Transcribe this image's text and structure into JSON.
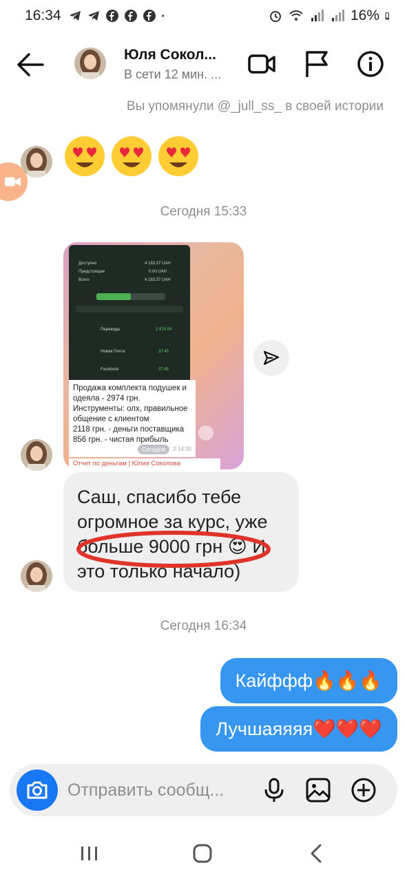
{
  "status_bar": {
    "time": "16:34",
    "battery": "16%"
  },
  "header": {
    "name": "Юля Сокол...",
    "status": "В сети 12 мин. ..."
  },
  "mention_note": "Вы упомянули @_jull_ss_ в своей истории",
  "reaction_emojis": "😍😍😍",
  "date_sep_1": "Сегодня 15:33",
  "shared_image": {
    "phone_rows": [
      "Доступно",
      "4 183.37 UAH",
      "Предстоящие",
      "0.00 UAH",
      "Всего",
      "4 183.37 UAH",
      "Переводы",
      "2 974.00",
      "Новая Почта",
      "37.45",
      "Facebook",
      "37.45"
    ],
    "caption_lines": [
      "Продажа комплекта подушек и",
      "одеяла - 2974 грн.",
      "Инструменты: олх, правильное",
      "общение с клиентом",
      "2118 грн. - деньги поставщика",
      "856 грн. - чистая прибыль"
    ],
    "caption_time": "2 14:30",
    "today_pill": "Сегодня",
    "report_label": "Отчет по деньгам | Юлия Соколова"
  },
  "incoming_message": "Саш, спасибо тебе огромное за курс, уже больше 9000 грн 😍 И это только начало)",
  "date_sep_2": "Сегодня 16:34",
  "outgoing_messages": [
    "Кайффф🔥🔥🔥",
    "Лучшаяяяя❤️❤️❤️"
  ],
  "composer": {
    "placeholder": "Отправить сообщ..."
  },
  "colors": {
    "accent": "#3797f0",
    "camera": "#1877f2",
    "bubble_in": "#efefef",
    "annotation": "#e0342a"
  }
}
